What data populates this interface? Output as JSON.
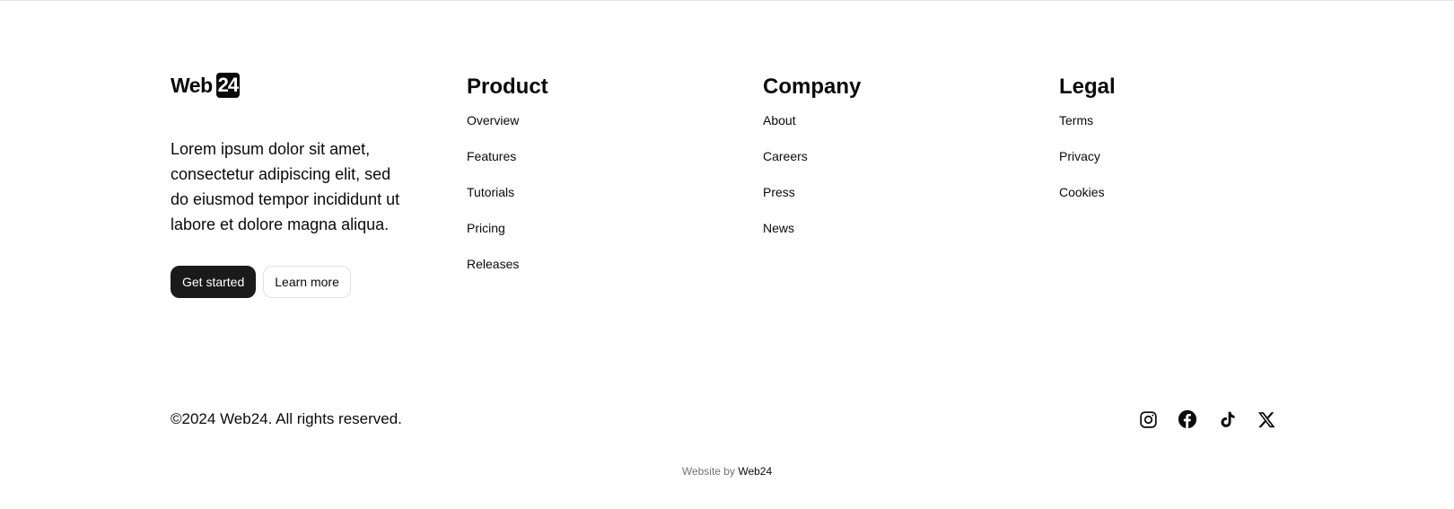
{
  "brand": {
    "logo_text": "Web",
    "logo_badge": "24",
    "tagline": "Lorem ipsum dolor sit amet, consectetur adipiscing elit, sed do eiusmod tempor incididunt ut labore et dolore magna aliqua.",
    "primary_button": "Get started",
    "secondary_button": "Learn more"
  },
  "columns": {
    "product": {
      "title": "Product",
      "links": [
        "Overview",
        "Features",
        "Tutorials",
        "Pricing",
        "Releases"
      ]
    },
    "company": {
      "title": "Company",
      "links": [
        "About",
        "Careers",
        "Press",
        "News"
      ]
    },
    "legal": {
      "title": "Legal",
      "links": [
        "Terms",
        "Privacy",
        "Cookies"
      ]
    }
  },
  "bottom": {
    "copyright": "©2024 Web24. All rights reserved.",
    "socials": [
      "instagram-icon",
      "facebook-icon",
      "tiktok-icon",
      "x-icon"
    ]
  },
  "credit": {
    "prefix": "Website by",
    "brand": "Web24"
  },
  "colors": {
    "text": "#0a0a0a",
    "primary_button_bg": "#1a1a1a",
    "muted_text": "#737373",
    "border": "#e0e0e0"
  }
}
